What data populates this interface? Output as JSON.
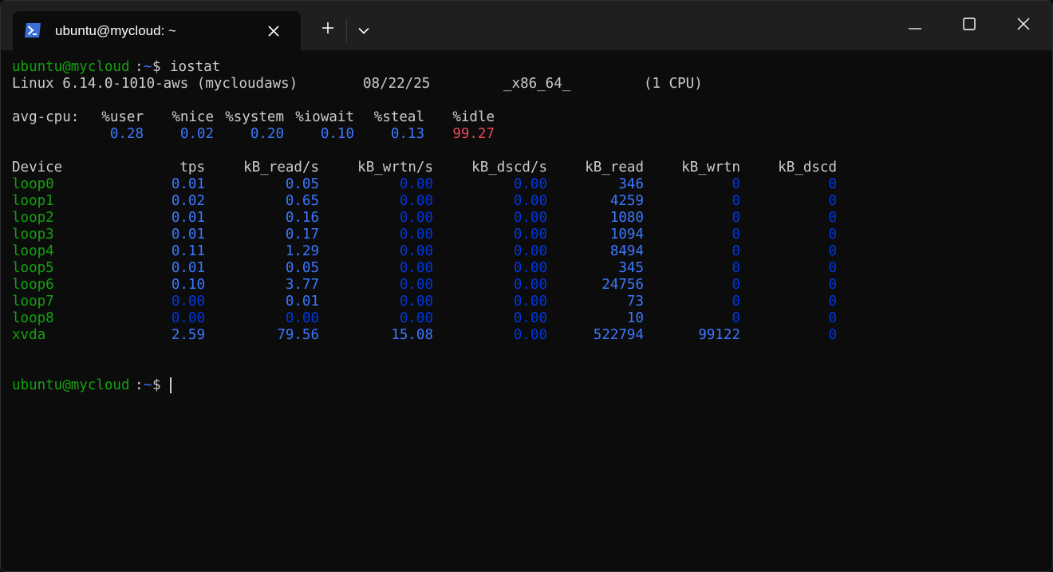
{
  "window": {
    "tab_title": "ubuntu@mycloud: ~",
    "tab_icon": "powershell-icon"
  },
  "terminal": {
    "prompt_user": "ubuntu@mycloud",
    "prompt_sep": ":",
    "prompt_path": "~",
    "prompt_symbol": "$",
    "command": "iostat",
    "sysinfo": {
      "kernel": "Linux 6.14.0-1010-aws (mycloudaws)",
      "date": "08/22/25",
      "arch": "_x86_64_",
      "cpus": "(1 CPU)"
    },
    "cpu": {
      "label": "avg-cpu:",
      "headers": [
        "%user",
        "%nice",
        "%system",
        "%iowait",
        "%steal",
        "%idle"
      ],
      "values": [
        "0.28",
        "0.02",
        "0.20",
        "0.10",
        "0.13",
        "99.27"
      ]
    },
    "devices": {
      "headers": [
        "Device",
        "tps",
        "kB_read/s",
        "kB_wrtn/s",
        "kB_dscd/s",
        "kB_read",
        "kB_wrtn",
        "kB_dscd"
      ],
      "rows": [
        [
          "loop0",
          "0.01",
          "0.05",
          "0.00",
          "0.00",
          "346",
          "0",
          "0"
        ],
        [
          "loop1",
          "0.02",
          "0.65",
          "0.00",
          "0.00",
          "4259",
          "0",
          "0"
        ],
        [
          "loop2",
          "0.01",
          "0.16",
          "0.00",
          "0.00",
          "1080",
          "0",
          "0"
        ],
        [
          "loop3",
          "0.01",
          "0.17",
          "0.00",
          "0.00",
          "1094",
          "0",
          "0"
        ],
        [
          "loop4",
          "0.11",
          "1.29",
          "0.00",
          "0.00",
          "8494",
          "0",
          "0"
        ],
        [
          "loop5",
          "0.01",
          "0.05",
          "0.00",
          "0.00",
          "345",
          "0",
          "0"
        ],
        [
          "loop6",
          "0.10",
          "3.77",
          "0.00",
          "0.00",
          "24756",
          "0",
          "0"
        ],
        [
          "loop7",
          "0.00",
          "0.01",
          "0.00",
          "0.00",
          "73",
          "0",
          "0"
        ],
        [
          "loop8",
          "0.00",
          "0.00",
          "0.00",
          "0.00",
          "10",
          "0",
          "0"
        ],
        [
          "xvda",
          "2.59",
          "79.56",
          "15.08",
          "0.00",
          "522794",
          "99122",
          "0"
        ]
      ]
    }
  },
  "colors": {
    "prompt_user": "#13a10e",
    "prompt_path": "#3b78ff",
    "value_bright": "#3b78ff",
    "value_dim": "#0037da",
    "idle": "#e74856",
    "text": "#cccccc",
    "background": "#0c0c0c"
  }
}
